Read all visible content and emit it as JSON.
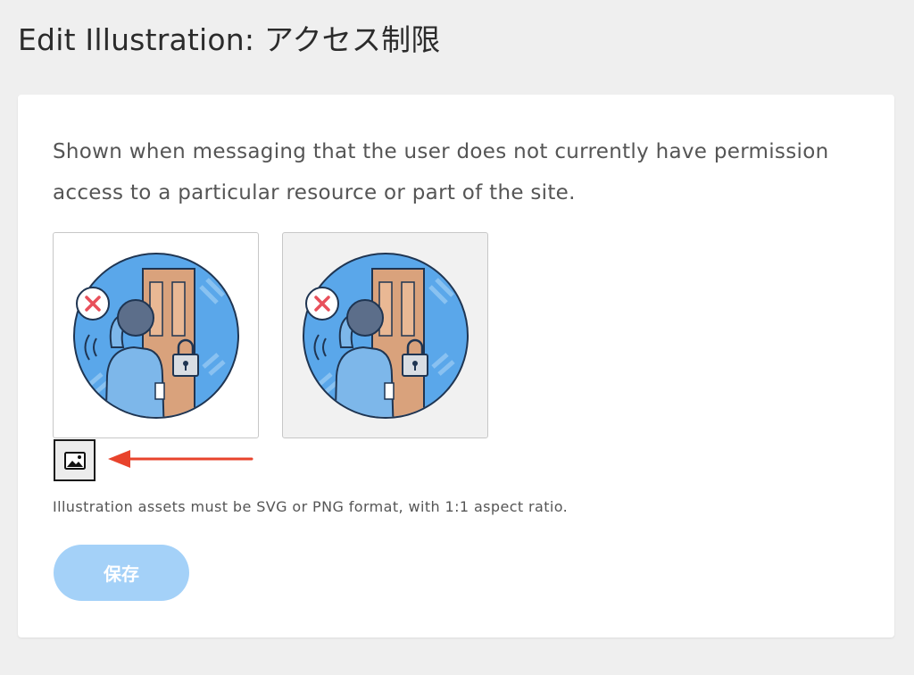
{
  "page": {
    "title": "Edit Illustration: アクセス制限"
  },
  "card": {
    "description": "Shown when messaging that the user does not currently have permission access to a particular resource or part of the site.",
    "previews": [
      {
        "variant": "light-background",
        "icon": "access-denied-illustration"
      },
      {
        "variant": "gray-background",
        "icon": "access-denied-illustration"
      }
    ],
    "image_picker_icon": "image-icon",
    "help_text": "Illustration assets must be SVG or PNG format, with 1:1 aspect ratio.",
    "save_label": "保存"
  },
  "colors": {
    "annotation_arrow": "#e8432c",
    "save_button_bg": "#a4d1f8",
    "illustration_blue": "#5aa7ea",
    "door": "#d9a27c",
    "deny_x": "#e8505b"
  }
}
